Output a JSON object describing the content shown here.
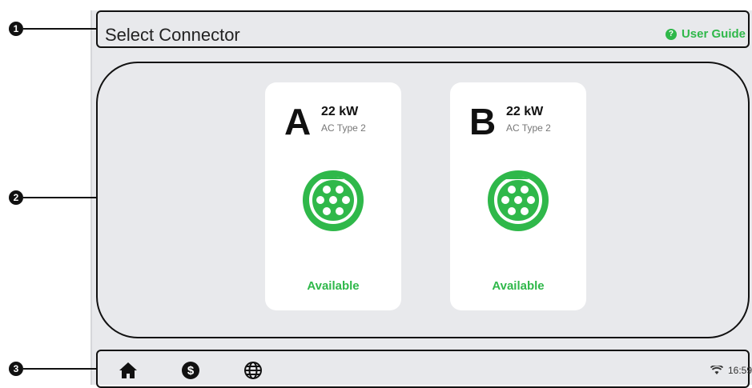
{
  "header": {
    "title": "Select Connector",
    "user_guide_label": "User Guide",
    "user_guide_icon": "question-icon"
  },
  "connectors": [
    {
      "letter": "A",
      "power": "22 kW",
      "type": "AC Type 2",
      "status": "Available",
      "icon": "type2-plug-icon"
    },
    {
      "letter": "B",
      "power": "22 kW",
      "type": "AC Type 2",
      "status": "Available",
      "icon": "type2-plug-icon"
    }
  ],
  "callouts": [
    "❶",
    "❷",
    "❸"
  ],
  "footer": {
    "icons": [
      "home-icon",
      "dollar-icon",
      "globe-icon"
    ],
    "wifi_icon": "wifi-icon",
    "time": "16:59"
  },
  "colors": {
    "accent": "#2fb84a",
    "background": "#e8e9ec",
    "card": "#ffffff"
  }
}
